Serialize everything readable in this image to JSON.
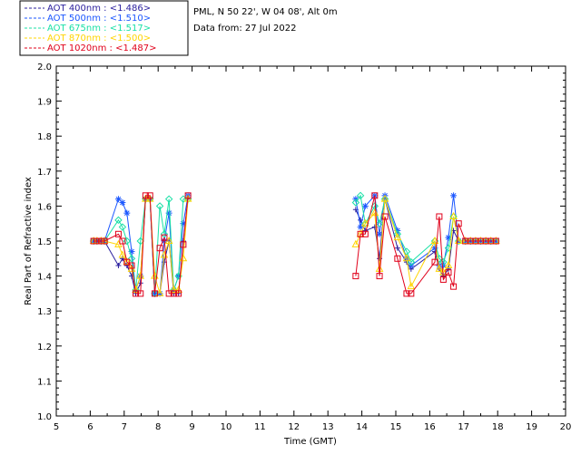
{
  "header": {
    "location": "PML, N 50 22', W 04 08', Alt 0m",
    "date_line": "Data from: 27 Jul 2022"
  },
  "colors": {
    "aot400": "#2a1f9e",
    "aot500": "#1a56ff",
    "aot675": "#18e0a6",
    "aot870": "#ffd400",
    "aot1020": "#e0001a"
  },
  "chart_data": {
    "type": "scatter",
    "title": "",
    "xlabel": "Time (GMT)",
    "ylabel": "Real Part of Refractive index",
    "xlim": [
      5,
      20
    ],
    "ylim": [
      1.0,
      2.0
    ],
    "x_ticks": [
      "5",
      "6",
      "7",
      "8",
      "9",
      "10",
      "11",
      "12",
      "13",
      "14",
      "15",
      "16",
      "17",
      "18",
      "19",
      "20"
    ],
    "y_ticks": [
      "1.0",
      "1.1",
      "1.2",
      "1.3",
      "1.4",
      "1.5",
      "1.6",
      "1.7",
      "1.8",
      "1.9",
      "2.0"
    ],
    "grid": false,
    "legend_position": "top-left-outside",
    "series": [
      {
        "name": "AOT  400nm : <1.486>",
        "color": "#2a1f9e",
        "marker": "plus",
        "x": [
          6.1,
          6.2,
          6.32,
          6.42,
          6.83,
          6.95,
          7.08,
          7.22,
          7.34,
          7.48,
          7.63,
          7.76,
          7.9,
          8.05,
          8.18,
          8.32,
          8.46,
          8.6,
          8.74,
          8.88,
          13.82,
          13.96,
          14.1,
          14.38,
          14.52,
          14.68,
          15.05,
          15.32,
          15.45,
          16.15,
          16.28,
          16.4,
          16.55,
          16.7,
          16.85,
          17.05,
          17.2,
          17.35,
          17.5,
          17.65,
          17.8,
          17.95
        ],
        "y": [
          1.5,
          1.5,
          1.5,
          1.5,
          1.43,
          1.45,
          1.43,
          1.4,
          1.35,
          1.38,
          1.62,
          1.62,
          1.35,
          1.35,
          1.44,
          1.5,
          1.35,
          1.35,
          1.5,
          1.62,
          1.59,
          1.56,
          1.53,
          1.54,
          1.45,
          1.62,
          1.48,
          1.44,
          1.42,
          1.47,
          1.42,
          1.4,
          1.42,
          1.53,
          1.5,
          1.5,
          1.5,
          1.5,
          1.5,
          1.5,
          1.5,
          1.5
        ]
      },
      {
        "name": "AOT  500nm : <1.510>",
        "color": "#1a56ff",
        "marker": "star",
        "x": [
          6.1,
          6.2,
          6.32,
          6.42,
          6.83,
          6.95,
          7.08,
          7.22,
          7.34,
          7.48,
          7.63,
          7.76,
          7.9,
          8.05,
          8.18,
          8.32,
          8.46,
          8.6,
          8.74,
          8.88,
          13.82,
          13.96,
          14.1,
          14.38,
          14.52,
          14.68,
          15.05,
          15.32,
          15.45,
          16.15,
          16.28,
          16.4,
          16.55,
          16.7,
          16.85,
          17.05,
          17.2,
          17.35,
          17.5,
          17.65,
          17.8,
          17.95
        ],
        "y": [
          1.5,
          1.5,
          1.5,
          1.5,
          1.62,
          1.61,
          1.58,
          1.47,
          1.36,
          1.4,
          1.62,
          1.62,
          1.35,
          1.35,
          1.5,
          1.58,
          1.36,
          1.4,
          1.55,
          1.63,
          1.62,
          1.54,
          1.6,
          1.63,
          1.52,
          1.63,
          1.53,
          1.45,
          1.43,
          1.48,
          1.43,
          1.43,
          1.51,
          1.63,
          1.5,
          1.5,
          1.5,
          1.5,
          1.5,
          1.5,
          1.5,
          1.5
        ]
      },
      {
        "name": "AOT  675nm : <1.517>",
        "color": "#18e0a6",
        "marker": "diamond",
        "x": [
          6.1,
          6.2,
          6.32,
          6.42,
          6.83,
          6.95,
          7.08,
          7.22,
          7.34,
          7.48,
          7.63,
          7.76,
          7.9,
          8.05,
          8.18,
          8.32,
          8.46,
          8.6,
          8.74,
          8.88,
          13.82,
          13.96,
          14.1,
          14.38,
          14.52,
          14.68,
          15.05,
          15.32,
          15.45,
          16.15,
          16.28,
          16.4,
          16.55,
          16.7,
          16.85,
          17.05,
          17.2,
          17.35,
          17.5,
          17.65,
          17.8,
          17.95
        ],
        "y": [
          1.5,
          1.5,
          1.5,
          1.5,
          1.56,
          1.54,
          1.5,
          1.45,
          1.36,
          1.5,
          1.62,
          1.62,
          1.35,
          1.6,
          1.52,
          1.62,
          1.36,
          1.4,
          1.62,
          1.62,
          1.61,
          1.63,
          1.55,
          1.6,
          1.55,
          1.62,
          1.52,
          1.47,
          1.44,
          1.5,
          1.45,
          1.44,
          1.48,
          1.57,
          1.5,
          1.5,
          1.5,
          1.5,
          1.5,
          1.5,
          1.5,
          1.5
        ]
      },
      {
        "name": "AOT  870nm : <1.500>",
        "color": "#ffd400",
        "marker": "triangle",
        "x": [
          6.1,
          6.2,
          6.32,
          6.42,
          6.83,
          6.95,
          7.08,
          7.22,
          7.34,
          7.48,
          7.63,
          7.76,
          7.9,
          8.05,
          8.18,
          8.32,
          8.46,
          8.6,
          8.74,
          8.88,
          13.82,
          13.96,
          14.1,
          14.38,
          14.52,
          14.68,
          15.05,
          15.32,
          15.45,
          16.15,
          16.28,
          16.4,
          16.55,
          16.7,
          16.85,
          17.05,
          17.2,
          17.35,
          17.5,
          17.65,
          17.8,
          17.95
        ],
        "y": [
          1.5,
          1.5,
          1.5,
          1.5,
          1.49,
          1.46,
          1.44,
          1.42,
          1.36,
          1.4,
          1.62,
          1.62,
          1.4,
          1.35,
          1.46,
          1.5,
          1.36,
          1.36,
          1.45,
          1.62,
          1.49,
          1.52,
          1.55,
          1.58,
          1.42,
          1.62,
          1.51,
          1.45,
          1.37,
          1.5,
          1.42,
          1.41,
          1.43,
          1.57,
          1.5,
          1.5,
          1.5,
          1.5,
          1.5,
          1.5,
          1.5,
          1.5
        ]
      },
      {
        "name": "AOT 1020nm : <1.487>",
        "color": "#e0001a",
        "marker": "square",
        "x": [
          6.1,
          6.2,
          6.32,
          6.42,
          6.83,
          6.95,
          7.08,
          7.22,
          7.34,
          7.48,
          7.63,
          7.76,
          7.9,
          8.05,
          8.18,
          8.32,
          8.46,
          8.6,
          8.74,
          8.88,
          13.82,
          13.96,
          14.1,
          14.38,
          14.52,
          14.68,
          15.05,
          15.32,
          15.45,
          16.15,
          16.28,
          16.4,
          16.55,
          16.7,
          16.85,
          17.05,
          17.2,
          17.35,
          17.5,
          17.65,
          17.8,
          17.95
        ],
        "y": [
          1.5,
          1.5,
          1.5,
          1.5,
          1.52,
          1.5,
          1.44,
          1.43,
          1.35,
          1.35,
          1.63,
          1.63,
          1.35,
          1.48,
          1.51,
          1.35,
          1.35,
          1.35,
          1.49,
          1.63,
          1.4,
          1.52,
          1.52,
          1.63,
          1.4,
          1.57,
          1.45,
          1.35,
          1.35,
          1.44,
          1.57,
          1.39,
          1.41,
          1.37,
          1.55,
          1.5,
          1.5,
          1.5,
          1.5,
          1.5,
          1.5,
          1.5
        ]
      }
    ]
  }
}
